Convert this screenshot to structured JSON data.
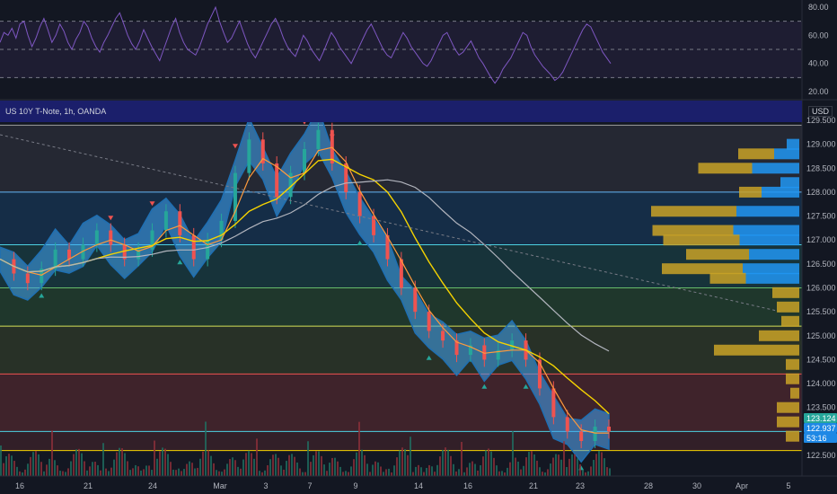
{
  "symbol": {
    "title": "US 10Y T-Note, 1h, OANDA",
    "currency": "USD"
  },
  "colors": {
    "bg": "#131722",
    "band": "#1f6fb2",
    "fast_ma": "#ff9a3c",
    "mid_ma": "#f5d300",
    "slow_ma": "#b2b5be",
    "vp_up": "#2196f3",
    "vp_down": "#c9a227",
    "rsi": "#7e57c2",
    "bull_marker": "#26a69a",
    "bear_marker": "#ef5350"
  },
  "rsi_panel": {
    "axis_ticks": [
      "80.00",
      "60.00",
      "40.00",
      "20.00"
    ],
    "levels": [
      70,
      50,
      30
    ],
    "series": [
      55,
      62,
      60,
      65,
      58,
      68,
      70,
      60,
      52,
      58,
      66,
      72,
      64,
      55,
      60,
      68,
      63,
      55,
      50,
      57,
      62,
      70,
      66,
      58,
      52,
      48,
      55,
      60,
      66,
      72,
      76,
      68,
      60,
      54,
      50,
      56,
      64,
      58,
      52,
      47,
      42,
      50,
      58,
      66,
      72,
      62,
      55,
      50,
      48,
      46,
      52,
      60,
      68,
      74,
      80,
      70,
      62,
      55,
      58,
      64,
      70,
      62,
      54,
      48,
      44,
      50,
      56,
      62,
      68,
      72,
      66,
      58,
      52,
      48,
      45,
      52,
      60,
      56,
      50,
      46,
      42,
      48,
      55,
      62,
      58,
      52,
      48,
      44,
      40,
      46,
      52,
      58,
      64,
      68,
      62,
      56,
      50,
      46,
      44,
      50,
      56,
      62,
      58,
      52,
      48,
      44,
      40,
      38,
      42,
      48,
      54,
      60,
      62,
      56,
      50,
      46,
      48,
      52,
      56,
      50,
      44,
      40,
      35,
      30,
      26,
      30,
      36,
      40,
      44,
      50,
      56,
      62,
      60,
      52,
      46,
      42,
      38,
      35,
      32,
      28,
      30,
      34,
      40,
      46,
      52,
      58,
      64,
      68,
      66,
      60,
      54,
      48,
      44,
      40
    ]
  },
  "price_panel": {
    "y_ticks": [
      "129.500",
      "129.000",
      "128.500",
      "128.000",
      "127.500",
      "127.000",
      "126.500",
      "126.000",
      "125.500",
      "125.000",
      "124.500",
      "124.000",
      "123.500",
      "123.000",
      "122.500"
    ],
    "x_ticks": [
      "16",
      "21",
      "24",
      "Mar",
      "3",
      "7",
      "9",
      "14",
      "16",
      "21",
      "23",
      "28",
      "30",
      "Apr",
      "5"
    ],
    "pills": [
      {
        "label": "123.124",
        "color": "#26a69a"
      },
      {
        "label": "122.937",
        "color": "#1e88e5"
      },
      {
        "label": "53:16",
        "color": "#1e88e5"
      }
    ]
  },
  "chart_data": {
    "type": "line",
    "title": "US 10Y T-Note, 1h, OANDA",
    "ylim": [
      122.3,
      129.7
    ],
    "x_categories": [
      "16",
      "21",
      "24",
      "Mar",
      "3",
      "7",
      "9",
      "14",
      "16",
      "21",
      "23",
      "28",
      "30",
      "Apr",
      "5"
    ],
    "series": [
      {
        "name": "",
        "values": [
          126.6,
          126.3,
          126.1,
          126.4,
          126.8,
          126.6,
          126.9,
          127.2,
          126.9,
          126.6,
          126.8,
          127.2,
          127.6,
          127.1,
          126.6,
          127.0,
          127.4,
          128.4,
          129.1,
          128.6,
          127.9,
          128.4,
          128.9,
          129.3,
          128.6,
          128.0,
          127.5,
          127.1,
          126.6,
          126.0,
          125.5,
          125.1,
          124.9,
          124.6,
          124.8,
          124.5,
          124.7,
          124.9,
          124.5,
          123.9,
          123.3,
          123.0,
          122.8,
          123.1,
          123.0
        ]
      }
    ]
  }
}
